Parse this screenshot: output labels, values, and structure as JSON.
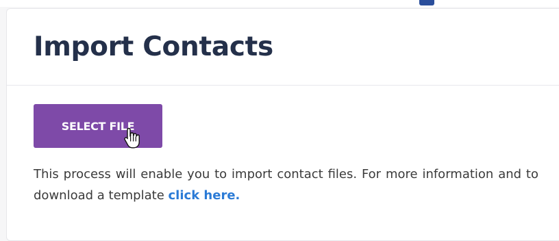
{
  "card": {
    "title": "Import Contacts"
  },
  "button": {
    "select_file_label": "SELECT FILE"
  },
  "description": {
    "text": "This process will enable you to import contact files. For more information and to download a template",
    "link_label": "click here."
  },
  "colors": {
    "button_bg": "#7e4aa8",
    "title": "#24304a",
    "link": "#2b7bd6"
  },
  "icons": {
    "cursor": "hand-pointer-icon"
  }
}
